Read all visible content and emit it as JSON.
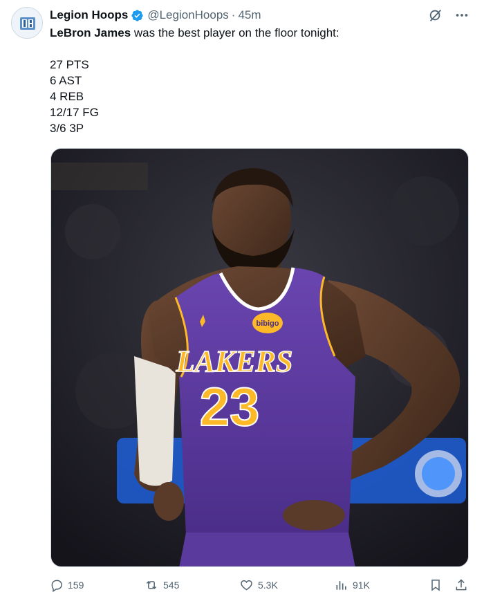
{
  "account": {
    "display_name": "Legion Hoops",
    "handle": "@LegionHoops",
    "separator": "·",
    "time_ago": "45m",
    "avatar_icon": "legion-hoops-logo",
    "verified_icon": "verified-badge-icon",
    "verified_color": "#1d9bf0"
  },
  "tweet": {
    "mention": "LeBron James",
    "text_rest": " was the best player on the floor tonight:",
    "stats": [
      "27 PTS",
      "6 AST",
      "4 REB",
      "12/17 FG",
      "3/6 3P"
    ]
  },
  "media": {
    "jersey": {
      "team": "LAKERS",
      "number": "23",
      "sponsor": "bibigo",
      "jersey_color": "#5b3a9e",
      "trim_color": "#fdb927"
    }
  },
  "actions": {
    "replies": "159",
    "reposts": "545",
    "likes": "5.3K",
    "views": "91K",
    "reply_icon": "reply-icon",
    "repost_icon": "repost-icon",
    "like_icon": "heart-icon",
    "views_icon": "analytics-icon",
    "bookmark_icon": "bookmark-icon",
    "share_icon": "share-icon"
  },
  "colors": {
    "text_primary": "#0f1419",
    "text_secondary": "#536471",
    "accent": "#1d9bf0"
  }
}
